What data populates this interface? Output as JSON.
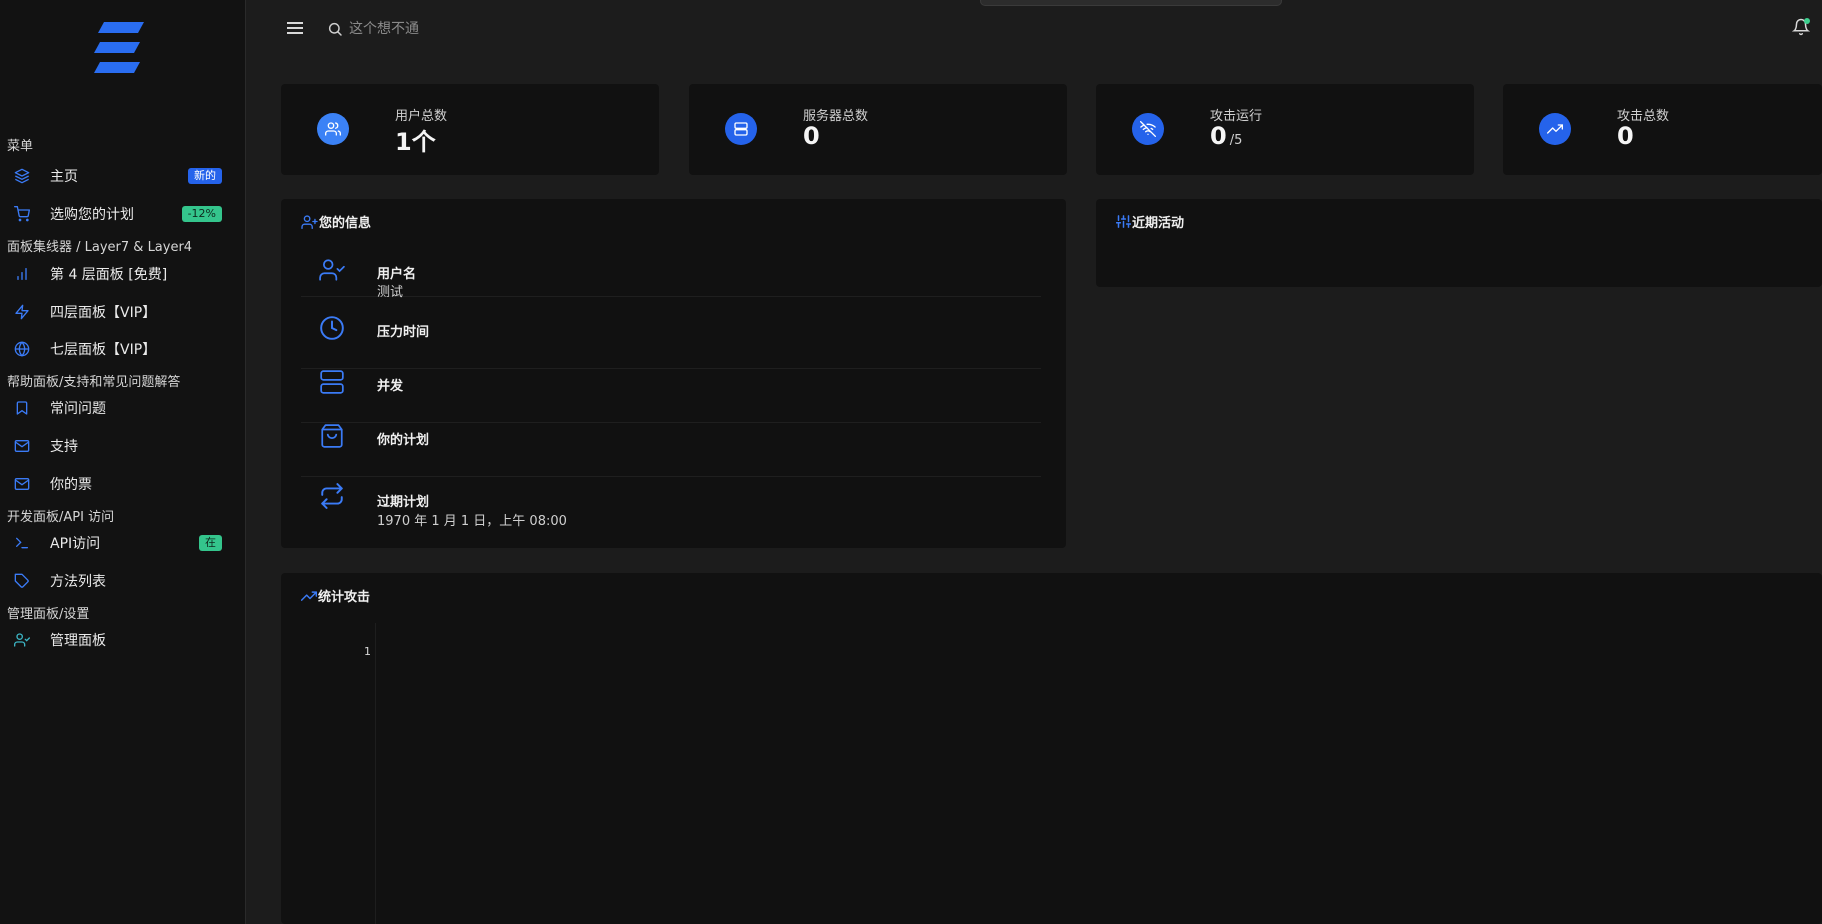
{
  "sidebar": {
    "sections": [
      {
        "title": "菜单"
      },
      {
        "title": "面板集线器 / Layer7 & Layer4"
      },
      {
        "title": "帮助面板/支持和常见问题解答"
      },
      {
        "title": "开发面板/API 访问"
      },
      {
        "title": "管理面板/设置"
      }
    ],
    "items": [
      {
        "label": "主页",
        "icon": "layers-icon",
        "badge": "新的"
      },
      {
        "label": "选购您的计划",
        "icon": "cart-icon",
        "badge": "-12%"
      },
      {
        "label": "第 4 层面板 [免费]",
        "icon": "bar-chart-icon"
      },
      {
        "label": "四层面板【VIP】",
        "icon": "lightning-icon"
      },
      {
        "label": "七层面板【VIP】",
        "icon": "globe-icon"
      },
      {
        "label": "常问问题",
        "icon": "bookmark-icon"
      },
      {
        "label": "支持",
        "icon": "mail-icon"
      },
      {
        "label": "你的票",
        "icon": "mail-icon"
      },
      {
        "label": "API访问",
        "icon": "terminal-icon",
        "badge": "在"
      },
      {
        "label": "方法列表",
        "icon": "tag-icon"
      },
      {
        "label": "管理面板",
        "icon": "user-check-icon"
      }
    ]
  },
  "header": {
    "search_placeholder": "这个想不通"
  },
  "stats": [
    {
      "label": "用户总数",
      "value": "1个",
      "icon": "users-icon"
    },
    {
      "label": "服务器总数",
      "value": "0",
      "icon": "server-icon"
    },
    {
      "label": "攻击运行",
      "value": "0",
      "suffix": "/5",
      "icon": "wifi-off-icon"
    },
    {
      "label": "攻击总数",
      "value": "0",
      "icon": "trending-up-icon"
    }
  ],
  "info_panel": {
    "title": "您的信息",
    "rows": [
      {
        "title": "用户名",
        "value": "测试",
        "icon": "user-check-icon"
      },
      {
        "title": "压力时间",
        "value": "",
        "icon": "clock-icon"
      },
      {
        "title": "并发",
        "value": "",
        "icon": "server-icon"
      },
      {
        "title": "你的计划",
        "value": "",
        "icon": "shopping-bag-icon"
      },
      {
        "title": "过期计划",
        "value": "1970 年 1 月 1 日，上午 08:00",
        "icon": "repeat-icon"
      }
    ]
  },
  "activity_panel": {
    "title": "近期活动"
  },
  "chart_panel": {
    "title": "统计攻击"
  },
  "chart_data": {
    "type": "line",
    "title": "统计攻击",
    "y_ticks": [
      "1"
    ],
    "series": []
  },
  "colors": {
    "accent": "#2563eb",
    "success": "#34c58c",
    "background": "#1c1c1c",
    "panel": "#111111",
    "sidebar": "#121212"
  }
}
